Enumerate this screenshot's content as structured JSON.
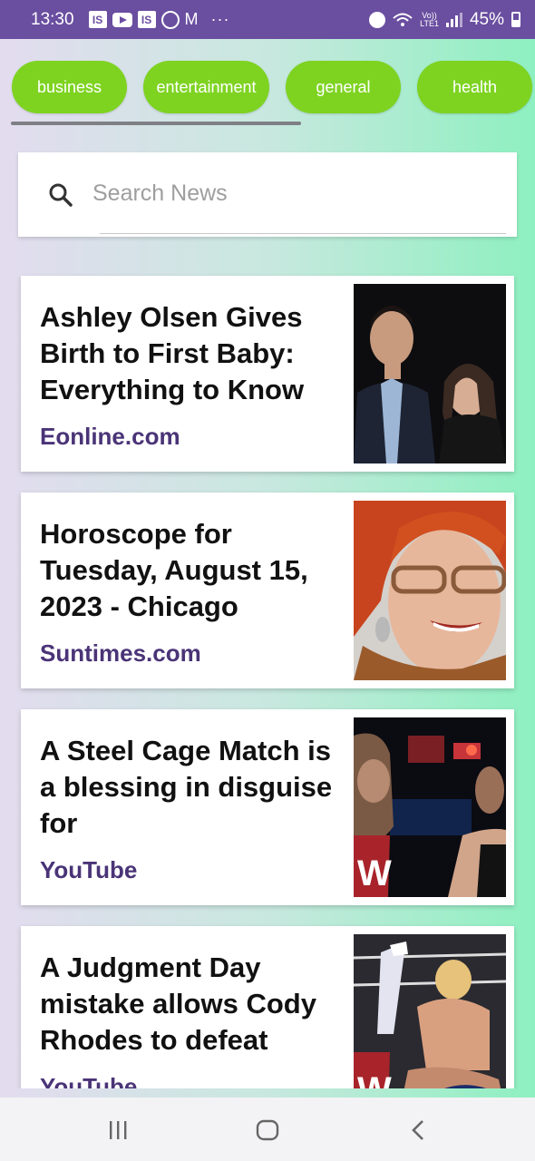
{
  "status_bar": {
    "time": "13:30",
    "battery_percent": "45%",
    "volte": "Vo))",
    "lte": "LTE1",
    "app_icons": [
      "IS",
      "youtube-icon",
      "IS",
      "whatsapp-icon",
      "gmail-icon"
    ],
    "more": "···"
  },
  "categories": {
    "items": [
      {
        "label": "business"
      },
      {
        "label": "entertainment"
      },
      {
        "label": "general"
      },
      {
        "label": "health"
      }
    ],
    "chip_color": "#7ed321"
  },
  "search": {
    "placeholder": "Search News",
    "value": ""
  },
  "articles": [
    {
      "title": "Ashley Olsen Gives Birth to First Baby: Everything to Know",
      "source": "Eonline.com"
    },
    {
      "title": "Horoscope for Tuesday, August 15, 2023 - Chicago",
      "source": "Suntimes.com"
    },
    {
      "title": "A Steel Cage Match is a blessing in disguise for",
      "source": "YouTube"
    },
    {
      "title": "A Judgment Day mistake allows Cody Rhodes to defeat",
      "source": "YouTube"
    }
  ],
  "colors": {
    "status_bar": "#6a4ea0",
    "source_text": "#4a3477",
    "title_text": "#111111"
  }
}
